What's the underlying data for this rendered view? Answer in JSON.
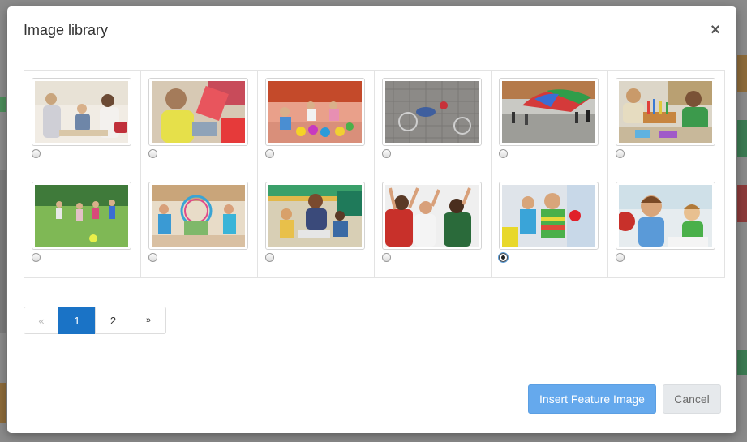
{
  "dialog": {
    "title": "Image library",
    "close_label": "×"
  },
  "images": [
    {
      "selected": false
    },
    {
      "selected": false
    },
    {
      "selected": false
    },
    {
      "selected": false
    },
    {
      "selected": false
    },
    {
      "selected": false
    },
    {
      "selected": false
    },
    {
      "selected": false
    },
    {
      "selected": false
    },
    {
      "selected": false
    },
    {
      "selected": true
    },
    {
      "selected": false
    }
  ],
  "pagination": {
    "prev": "«",
    "pages": [
      "1",
      "2"
    ],
    "current": "1",
    "next": "»"
  },
  "footer": {
    "insert_label": "Insert Feature Image",
    "cancel_label": "Cancel"
  },
  "colors": {
    "primary": "#1a73c6",
    "insert_button": "#65a9ed",
    "cancel_button": "#e6e9ec"
  }
}
